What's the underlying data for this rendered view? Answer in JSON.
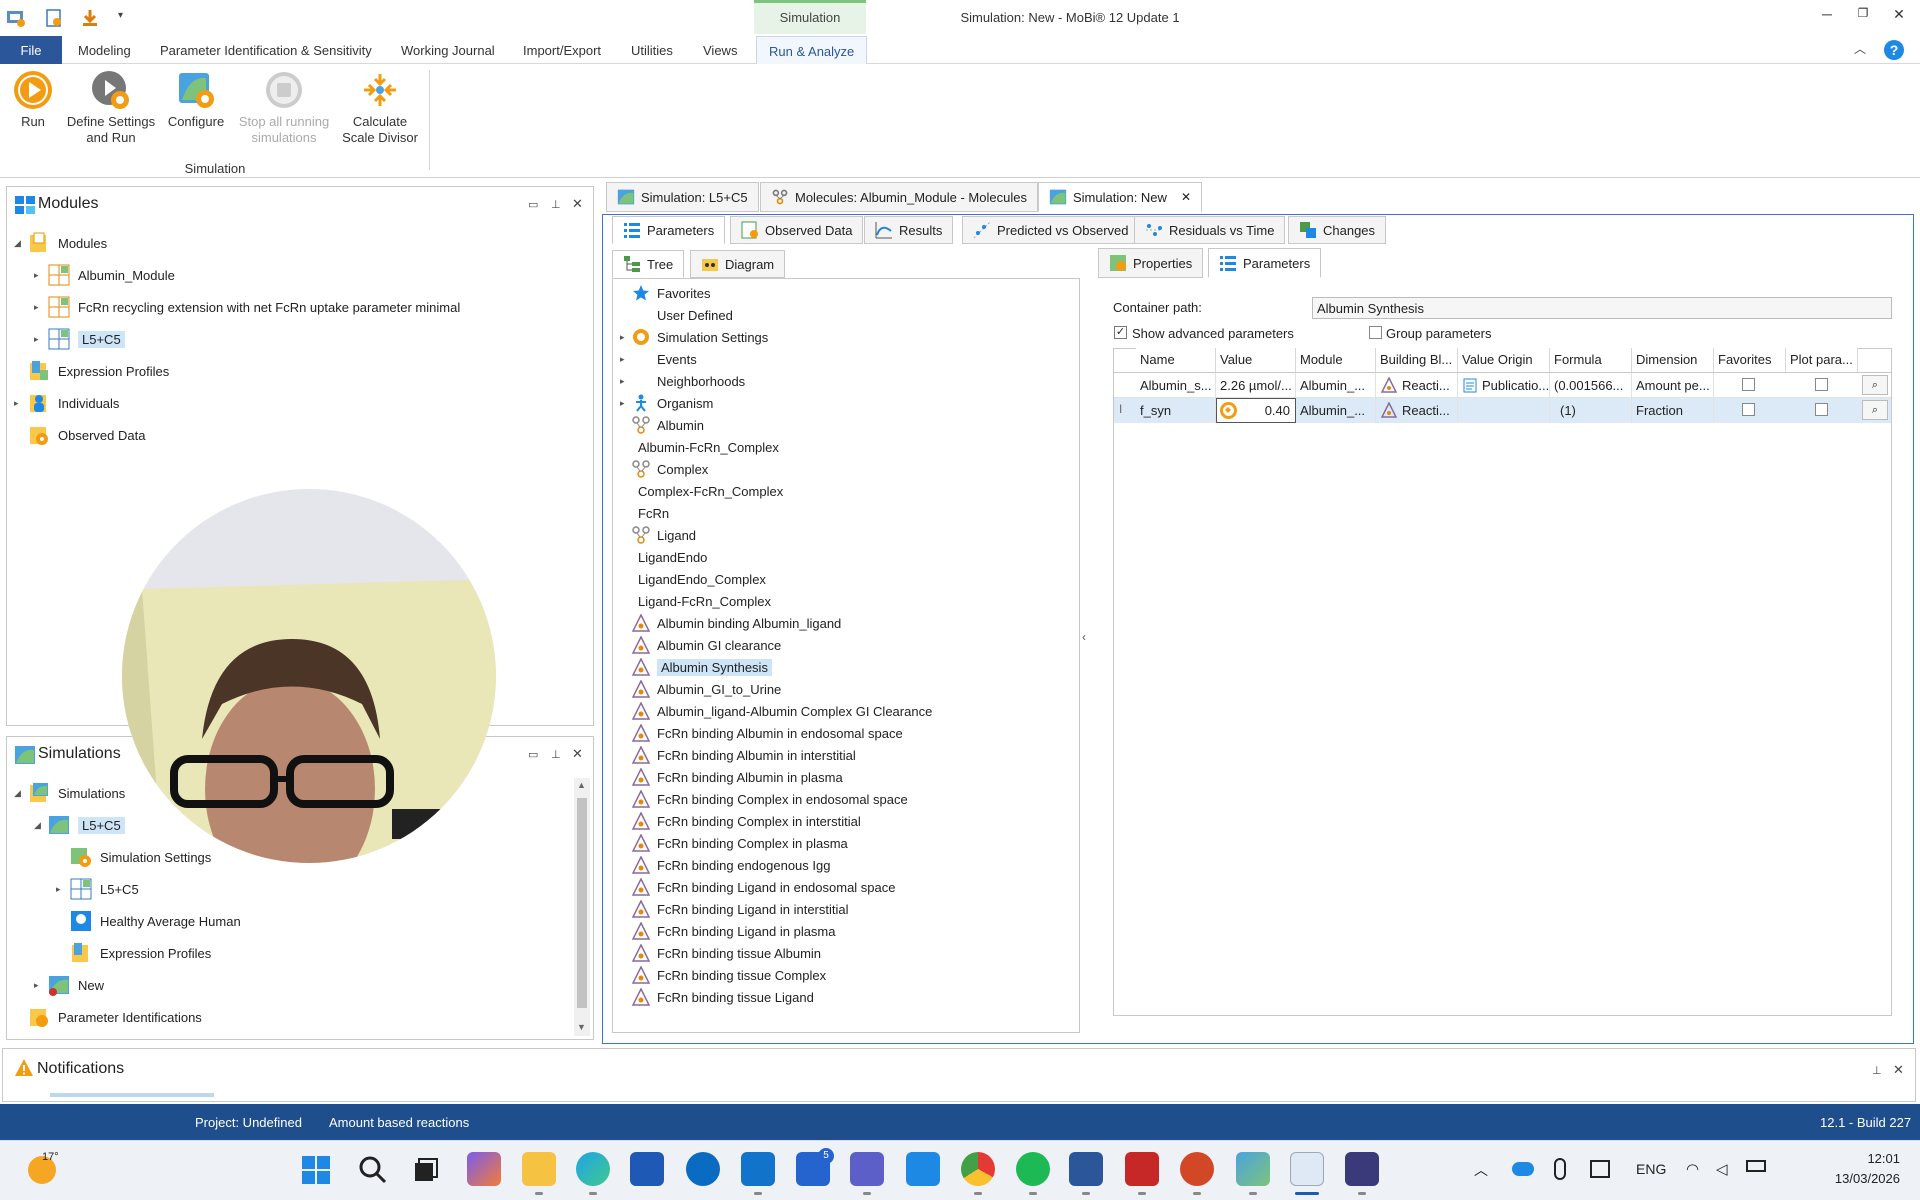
{
  "window": {
    "title": "Simulation: New - MoBi® 12 Update 1",
    "context_tab": "Simulation"
  },
  "menu": [
    "File",
    "Modeling",
    "Parameter Identification & Sensitivity",
    "Working Journal",
    "Import/Export",
    "Utilities",
    "Views",
    "Run & Analyze"
  ],
  "ribbon": {
    "buttons": [
      {
        "label": "Run",
        "icon": "run-icon"
      },
      {
        "label": "Define Settings and Run",
        "line1": "Define Settings",
        "line2": "and Run",
        "icon": "settings-run-icon"
      },
      {
        "label": "Configure",
        "icon": "configure-icon"
      },
      {
        "label": "Stop all running simulations",
        "line1": "Stop all running",
        "line2": "simulations",
        "icon": "stop-icon",
        "disabled": true
      },
      {
        "label": "Calculate Scale Divisor",
        "line1": "Calculate",
        "line2": "Scale Divisor",
        "icon": "scale-divisor-icon"
      }
    ],
    "group_label": "Simulation"
  },
  "modules_panel": {
    "title": "Modules",
    "items": [
      "Modules",
      "Albumin_Module",
      "FcRn recycling extension with net FcRn uptake parameter minimal",
      "L5+C5",
      "Expression Profiles",
      "Individuals",
      "Observed Data"
    ]
  },
  "simulations_panel": {
    "title": "Simulations",
    "items": [
      "Simulations",
      "L5+C5",
      "Simulation Settings",
      "L5+C5",
      "Healthy Average Human",
      "Expression Profiles",
      "New",
      "Parameter Identifications"
    ]
  },
  "notifications_panel": {
    "title": "Notifications"
  },
  "doc_tabs": [
    "Simulation: L5+C5",
    "Molecules: Albumin_Module - Molecules",
    "Simulation: New"
  ],
  "sub_tabs": [
    "Parameters",
    "Observed Data",
    "Results",
    "Predicted vs Observed",
    "Residuals vs Time",
    "Changes"
  ],
  "view_tabs": [
    "Tree",
    "Diagram"
  ],
  "right_tabs": [
    "Properties",
    "Parameters"
  ],
  "tree_items": [
    "Favorites",
    "User Defined",
    "Simulation Settings",
    "Events",
    "Neighborhoods",
    "Organism",
    "Albumin",
    "Albumin-FcRn_Complex",
    "Complex",
    "Complex-FcRn_Complex",
    "FcRn",
    "Ligand",
    "LigandEndo",
    "LigandEndo_Complex",
    "Ligand-FcRn_Complex",
    "Albumin binding Albumin_ligand",
    "Albumin GI clearance",
    "Albumin Synthesis",
    "Albumin_GI_to_Urine",
    "Albumin_ligand-Albumin Complex GI Clearance",
    "FcRn binding Albumin in endosomal space",
    "FcRn binding Albumin in interstitial",
    "FcRn binding Albumin in plasma",
    "FcRn binding Complex in endosomal space",
    "FcRn binding Complex in interstitial",
    "FcRn binding Complex in plasma",
    "FcRn binding endogenous Igg",
    "FcRn binding Ligand in endosomal space",
    "FcRn binding Ligand in interstitial",
    "FcRn binding Ligand in plasma",
    "FcRn binding tissue Albumin",
    "FcRn binding tissue Complex",
    "FcRn binding tissue Ligand"
  ],
  "params": {
    "container_path_label": "Container path:",
    "container_path_value": "Albumin Synthesis",
    "show_advanced_label": "Show advanced parameters",
    "show_advanced_checked": true,
    "group_params_label": "Group parameters",
    "group_params_checked": false,
    "columns": [
      "Name",
      "Value",
      "Module",
      "Building Bl...",
      "Value Origin",
      "Formula",
      "Dimension",
      "Favorites",
      "Plot para..."
    ],
    "rows": [
      {
        "name": "Albumin_s...",
        "value": "2.26 µmol/...",
        "module": "Albumin_...",
        "building_block": "Reacti...",
        "value_origin": "Publicatio...",
        "formula": "(0.001566...",
        "dimension": "Amount pe..."
      },
      {
        "name": "f_syn",
        "value": "0.40",
        "module": "Albumin_...",
        "building_block": "Reacti...",
        "value_origin": "",
        "formula": "(1)",
        "dimension": "Fraction"
      }
    ]
  },
  "statusbar": {
    "project": "Project: Undefined",
    "mode": "Amount based reactions",
    "build": "12.1 - Build 227"
  },
  "taskbar": {
    "weather": "17°",
    "lang": "ENG",
    "time": "12:01",
    "date": "13/03/2026",
    "badge_todo": "5"
  },
  "colors": {
    "accent": "#2b579a",
    "statusbar": "#1f4e8c",
    "selection": "#cde5f7",
    "run_orange": "#f39c12"
  }
}
